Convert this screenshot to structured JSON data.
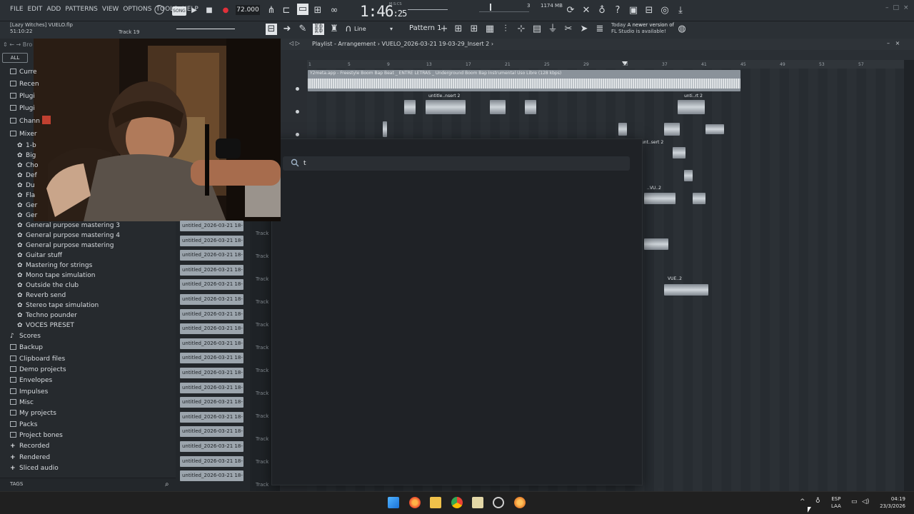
{
  "menu": [
    "FILE",
    "EDIT",
    "ADD",
    "PATTERNS",
    "VIEW",
    "OPTIONS",
    "TOOLS",
    "HELP"
  ],
  "transport": {
    "song_toggle": "SONG",
    "tempo": "72.000",
    "time": "1:46",
    "time_frac": ":25",
    "time_unit": "M:S:CS"
  },
  "cpu": {
    "memory": "1174 MB",
    "polyphony": "3"
  },
  "project": {
    "name": "[Lazy Witches] VUELO.flp",
    "elapsed": "51:10:22",
    "track_hint": "Track 19"
  },
  "toolbar": {
    "snap": "Line",
    "pattern": "Pattern 1"
  },
  "news": {
    "prefix": "Today",
    "title": "A newer version of",
    "title2": "FL Studio is available!"
  },
  "browser": {
    "all_tab": "ALL",
    "top_items": [
      "Curre",
      "Recen",
      "Plugi",
      "Plugi",
      "Chann",
      "Mixer"
    ],
    "mixer_items": [
      "1-b",
      "Big",
      "Cho",
      "Def",
      "Du",
      "Fla",
      "Ger",
      "Ger",
      "General purpose mastering 3",
      "General purpose mastering 4",
      "General purpose mastering",
      "Guitar stuff",
      "Mastering for strings",
      "Mono tape simulation",
      "Outside the club",
      "Reverb send",
      "Stereo tape simulation",
      "Techno pounder",
      "VOCES PRESET"
    ],
    "folders": [
      "Scores",
      "Backup",
      "Clipboard files",
      "Demo projects",
      "Envelopes",
      "Impulses",
      "Misc",
      "My projects",
      "Packs",
      "Project bones",
      "Recorded",
      "Rendered",
      "Sliced audio"
    ],
    "tags_label": "TAGS"
  },
  "clips": [
    "untitled_2026-03-21 18-",
    "untitled_2026-03-21 18-",
    "untitled_2026-03-21 18-",
    "untitled_2026-03-21 18-",
    "untitled_2026-03-21 18-",
    "untitled_2026-03-21 18-",
    "untitled_2026-03-21 18-",
    "untitled_2026-03-21 18-",
    "untitled_2026-03-21 18-",
    "untitled_2026-03-21 18-",
    "untitled_2026-03-21 18-",
    "untitled_2026-03-21 18-",
    "untitled_2026-03-21 18-",
    "untitled_2026-03-21 18-",
    "untitled_2026-03-21 18-",
    "untitled_2026-03-21 18-",
    "untitled_2026-03-21 18-",
    "untitled_2026-03-21 18-"
  ],
  "track_label": "Track",
  "playlist": {
    "title": "Playlist - Arrangement › VUELO_2026-03-21 19-03-29_Insert 2 ›",
    "ruler": [
      "1",
      "5",
      "9",
      "13",
      "17",
      "21",
      "25",
      "29",
      "33",
      "37",
      "41",
      "45",
      "49",
      "53",
      "57"
    ],
    "main_clip": "Y2meta.app - Freestyle Boom Bap Beat _ ENTRE LETRAS _ Underground Boom Bap Instrumental Uso Libre (128 kbps)",
    "clip_labels": [
      "untitle..nsert 2",
      "unti..rt 2",
      "unt..sert 2",
      "..VU..2",
      "VUE..2"
    ]
  },
  "search": {
    "value": "t",
    "placeholder": ""
  },
  "system": {
    "lang": "ESP",
    "lang2": "LAA",
    "time": "04:19",
    "date": "23/3/2026"
  },
  "colors": {
    "accent": "#d6dadd",
    "clip_bg": "#9ca5ad",
    "rec": "#e0303a"
  }
}
